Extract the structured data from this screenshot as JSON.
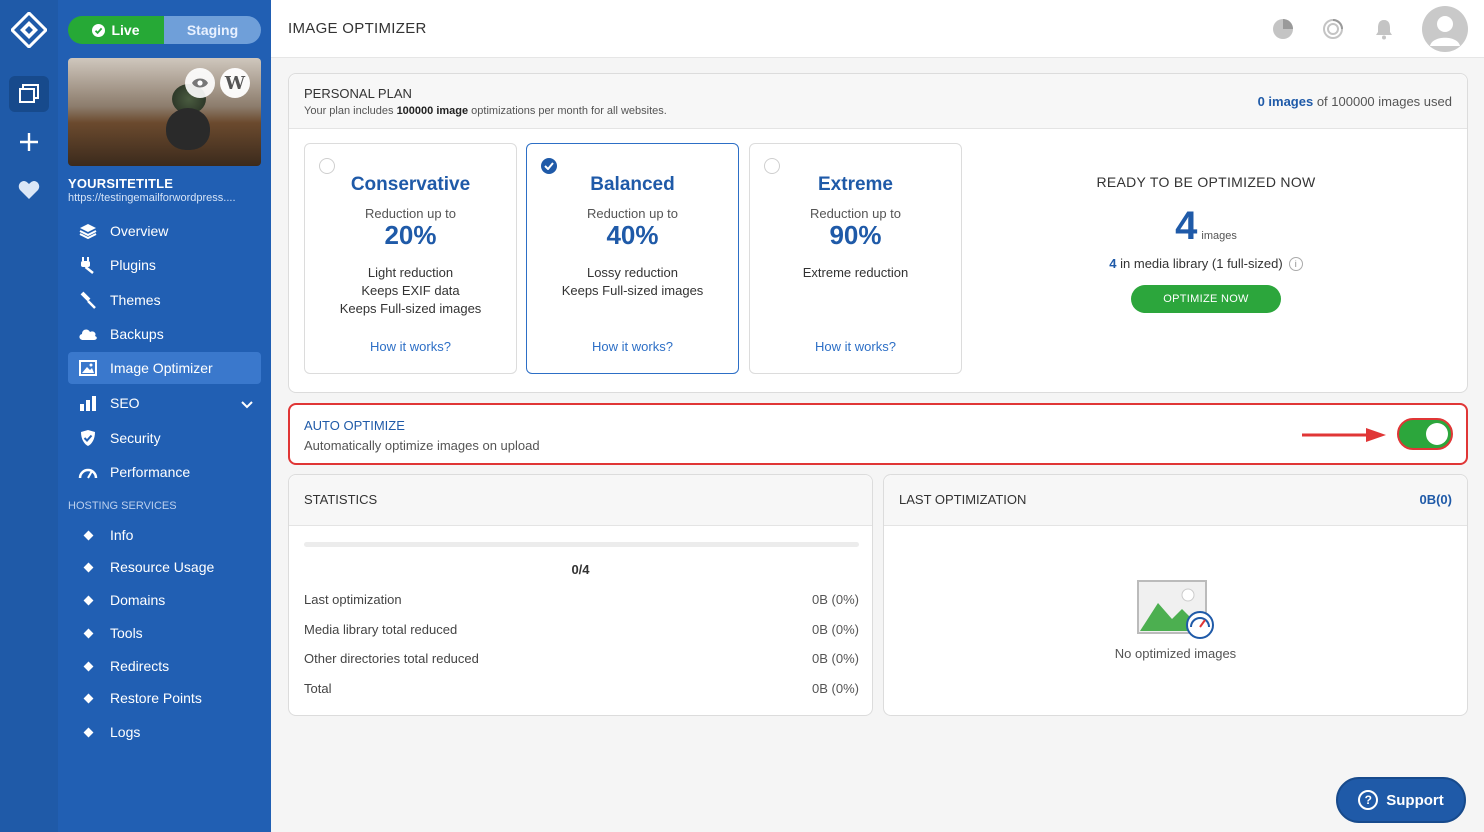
{
  "env": {
    "live": "Live",
    "staging": "Staging"
  },
  "site": {
    "title": "YOURSITETITLE",
    "url": "https://testingemailforwordpress...."
  },
  "nav": [
    {
      "label": "Overview",
      "icon": "layers-icon"
    },
    {
      "label": "Plugins",
      "icon": "plug-icon"
    },
    {
      "label": "Themes",
      "icon": "brush-icon"
    },
    {
      "label": "Backups",
      "icon": "cloud-icon"
    },
    {
      "label": "Image Optimizer",
      "icon": "image-icon"
    },
    {
      "label": "SEO",
      "icon": "bar-chart-icon"
    },
    {
      "label": "Security",
      "icon": "shield-icon"
    },
    {
      "label": "Performance",
      "icon": "gauge-icon"
    }
  ],
  "hosting": {
    "label": "HOSTING SERVICES",
    "items": [
      "Info",
      "Resource Usage",
      "Domains",
      "Tools",
      "Redirects",
      "Restore Points",
      "Logs"
    ]
  },
  "header": {
    "title": "IMAGE OPTIMIZER"
  },
  "plan": {
    "title": "PERSONAL PLAN",
    "sub_prefix": "Your plan includes ",
    "sub_bold": "100000 image",
    "sub_suffix": " optimizations per month for all websites.",
    "used_hl": "0 images",
    "used_rest": " of 100000 images used"
  },
  "cards": [
    {
      "name": "Conservative",
      "reduction": "Reduction up to",
      "pct": "20%",
      "features": [
        "Light reduction",
        "Keeps EXIF data",
        "Keeps Full-sized images"
      ],
      "how": "How it works?",
      "selected": false
    },
    {
      "name": "Balanced",
      "reduction": "Reduction up to",
      "pct": "40%",
      "features": [
        "Lossy reduction",
        "Keeps Full-sized images"
      ],
      "how": "How it works?",
      "selected": true
    },
    {
      "name": "Extreme",
      "reduction": "Reduction up to",
      "pct": "90%",
      "features": [
        "Extreme reduction"
      ],
      "how": "How it works?",
      "selected": false
    }
  ],
  "ready": {
    "title": "READY TO BE OPTIMIZED NOW",
    "count": "4",
    "count_label": "images",
    "media_n": "4",
    "media_rest": "in media library (1 full-sized)",
    "button": "OPTIMIZE NOW"
  },
  "auto": {
    "title": "AUTO OPTIMIZE",
    "sub": "Automatically optimize images on upload",
    "enabled": true
  },
  "stats": {
    "title": "STATISTICS",
    "progress_fraction": 0,
    "fraction": "0/4",
    "rows": [
      {
        "label": "Last optimization",
        "value": "0B (0%)"
      },
      {
        "label": "Media library total reduced",
        "value": "0B (0%)"
      },
      {
        "label": "Other directories total reduced",
        "value": "0B (0%)"
      },
      {
        "label": "Total",
        "value": "0B (0%)"
      }
    ]
  },
  "last_opt": {
    "title": "LAST OPTIMIZATION",
    "value": "0B(0)",
    "empty": "No optimized images"
  },
  "support": {
    "label": "Support"
  },
  "colors": {
    "brand_blue": "#1f5aa8",
    "green": "#2ca63c",
    "highlight_red": "#e03636"
  }
}
